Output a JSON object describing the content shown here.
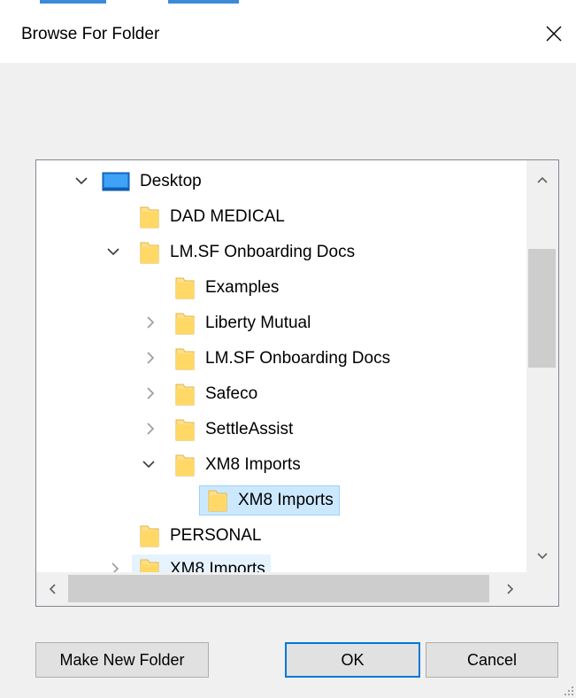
{
  "window": {
    "title": "Browse For Folder",
    "close_icon": "close-icon"
  },
  "tree": {
    "items": [
      {
        "label": "Desktop",
        "icon": "desktop-icon",
        "expander": "expanded",
        "selected": false
      },
      {
        "label": "DAD MEDICAL",
        "icon": "folder-icon",
        "expander": "none",
        "selected": false
      },
      {
        "label": "LM.SF Onboarding Docs",
        "icon": "folder-icon",
        "expander": "expanded",
        "selected": false
      },
      {
        "label": "Examples",
        "icon": "folder-icon",
        "expander": "none",
        "selected": false
      },
      {
        "label": "Liberty Mutual",
        "icon": "folder-icon",
        "expander": "collapsed",
        "selected": false
      },
      {
        "label": "LM.SF Onboarding Docs",
        "icon": "folder-icon",
        "expander": "collapsed",
        "selected": false
      },
      {
        "label": "Safeco",
        "icon": "folder-icon",
        "expander": "collapsed",
        "selected": false
      },
      {
        "label": "SettleAssist",
        "icon": "folder-icon",
        "expander": "collapsed",
        "selected": false
      },
      {
        "label": "XM8 Imports",
        "icon": "folder-icon",
        "expander": "expanded",
        "selected": false
      },
      {
        "label": "XM8 Imports",
        "icon": "folder-icon",
        "expander": "none",
        "selected": true
      },
      {
        "label": "PERSONAL",
        "icon": "folder-icon",
        "expander": "none",
        "selected": false
      },
      {
        "label": "XM8 Imports",
        "icon": "folder-icon",
        "expander": "collapsed",
        "selected": false,
        "hover": true
      }
    ]
  },
  "scrollbars": {
    "up_icon": "chevron-up-icon",
    "down_icon": "chevron-down-icon",
    "left_icon": "chevron-left-icon",
    "right_icon": "chevron-right-icon"
  },
  "buttons": {
    "make_new_folder": "Make New Folder",
    "ok": "OK",
    "cancel": "Cancel"
  },
  "colors": {
    "selection": "#cce8ff",
    "selection_border": "#99d1ff",
    "hover": "#e5f3ff",
    "folder": "#ffe08a",
    "default_button_border": "#0078d7"
  }
}
